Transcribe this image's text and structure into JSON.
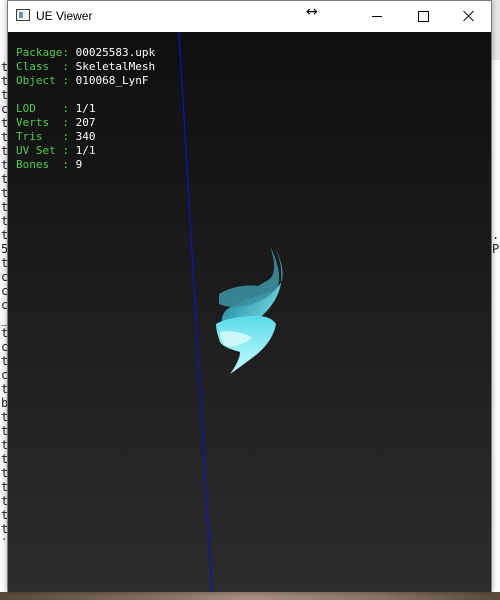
{
  "window": {
    "title": "UE Viewer"
  },
  "titlebar_icons": {
    "app": "app-window-icon",
    "resize": "resize-horizontal-icon",
    "minimize": "minimize-icon",
    "maximize": "maximize-icon",
    "close": "close-icon"
  },
  "info_top": [
    {
      "label": "Package",
      "value": "00025583.upk"
    },
    {
      "label": "Class  ",
      "value": "SkeletalMesh"
    },
    {
      "label": "Object ",
      "value": "010068_LynF"
    }
  ],
  "info_bottom": [
    {
      "label": "LOD    ",
      "value": "1/1"
    },
    {
      "label": "Verts  ",
      "value": "207"
    },
    {
      "label": "Tris   ",
      "value": "340"
    },
    {
      "label": "UV Set ",
      "value": "1/1"
    },
    {
      "label": "Bones  ",
      "value": "9"
    }
  ],
  "background_console": {
    "left_chars": [
      "t",
      "t",
      "t",
      "c",
      "t",
      "t",
      "t",
      "t",
      "t",
      "t",
      "t",
      "t",
      "t",
      "5",
      "t",
      "c",
      "c",
      "c",
      "_",
      "t",
      "c",
      "t",
      "c",
      "t",
      "b",
      "t",
      "t",
      "t",
      "t",
      "t",
      "t",
      "t",
      "t",
      "t",
      "t",
      "c"
    ],
    "right_chars": [
      "",
      "",
      "",
      "",
      "",
      "",
      "",
      "",
      "",
      "",
      "",
      "",
      ".",
      "P",
      "",
      "",
      "",
      "",
      "",
      "",
      "",
      "",
      "",
      "",
      "",
      "",
      "",
      "",
      "",
      "",
      "",
      "",
      "",
      "",
      "",
      ""
    ]
  },
  "colors": {
    "label_green": "#4ccf4c",
    "value_white": "#ffffff",
    "axis_blue": "#1010c8",
    "mesh_cyan": "#4fe3f0"
  }
}
